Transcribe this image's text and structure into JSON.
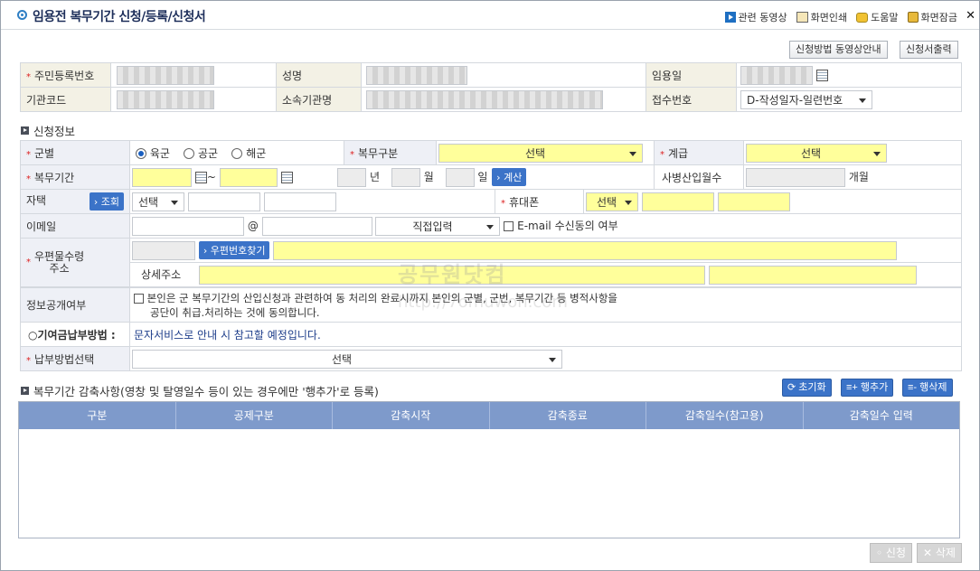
{
  "window": {
    "title": "임용전 복무기간 신청/등록/신청서",
    "links": [
      "관련 동영상",
      "화면인쇄",
      "도움말",
      "화면잠금"
    ]
  },
  "top_buttons": {
    "video_guide": "신청방법 동영상안내",
    "print_form": "신청서출력"
  },
  "basic": {
    "resident_no_label": "주민등록번호",
    "name_label": "성명",
    "appoint_date_label": "임용일",
    "org_code_label": "기관코드",
    "org_name_label": "소속기관명",
    "receipt_no_label": "접수번호",
    "receipt_no_value": "D-작성일자-일련번호"
  },
  "apply_section": {
    "title": "신청정보",
    "branch_label": "군별",
    "branch_options": [
      "육군",
      "공군",
      "해군"
    ],
    "service_type_label": "복무구분",
    "service_type_value": "선택",
    "rank_label": "계급",
    "rank_value": "선택",
    "period_label": "복무기간",
    "tilde": "~",
    "unit_year": "년",
    "unit_month": "월",
    "unit_day": "일",
    "calc_button": "계산",
    "months_label": "사병산입월수",
    "months_unit": "개월",
    "phone_label": "자택",
    "lookup_button": "조회",
    "phone_select": "선택",
    "mobile_label": "휴대폰",
    "mobile_select": "선택",
    "email_label": "이메일",
    "at": "@",
    "email_domain": "직접입력",
    "email_consent": "E-mail 수신동의 여부",
    "address_label_1": "우편물수령",
    "address_label_2": "주소",
    "zip_button": "우편번호찾기",
    "detail_address_label": "상세주소",
    "disclosure_label": "정보공개여부",
    "disclosure_text_1": "본인은 군 복무기간의 산입신청과 관련하여 동 처리의 완료시까지 본인의 군별, 군번, 복무기간 등 병적사항을",
    "disclosure_text_2": "공단이 취급.처리하는 것에 동의합니다.",
    "payment_method_label": "○기여금납부방법 :",
    "payment_method_note": "문자서비스로 안내 시 참고할 예정입니다.",
    "payment_select_label": "납부방법선택",
    "payment_select_value": "선택"
  },
  "reduction_section": {
    "title": "복무기간 감축사항(영창 및 탈영일수 등이 있는 경우에만 '행추가'로 등록)",
    "reset_button": "초기화",
    "add_row_button": "행추가",
    "delete_row_button": "행삭제",
    "columns": [
      "구분",
      "공제구분",
      "감축시작",
      "감축종료",
      "감축일수(참고용)",
      "감축일수 입력"
    ]
  },
  "footer": {
    "apply_button": "신청",
    "delete_button": "삭제"
  },
  "watermark": {
    "line1": "공무원닷컴",
    "line2": "http://7omuwon.com"
  },
  "colors": {
    "header_blue": "#7e9acb",
    "input_yellow": "#ffff9b",
    "button_blue": "#3b73c8",
    "label_bg": "#f3f1e5"
  }
}
